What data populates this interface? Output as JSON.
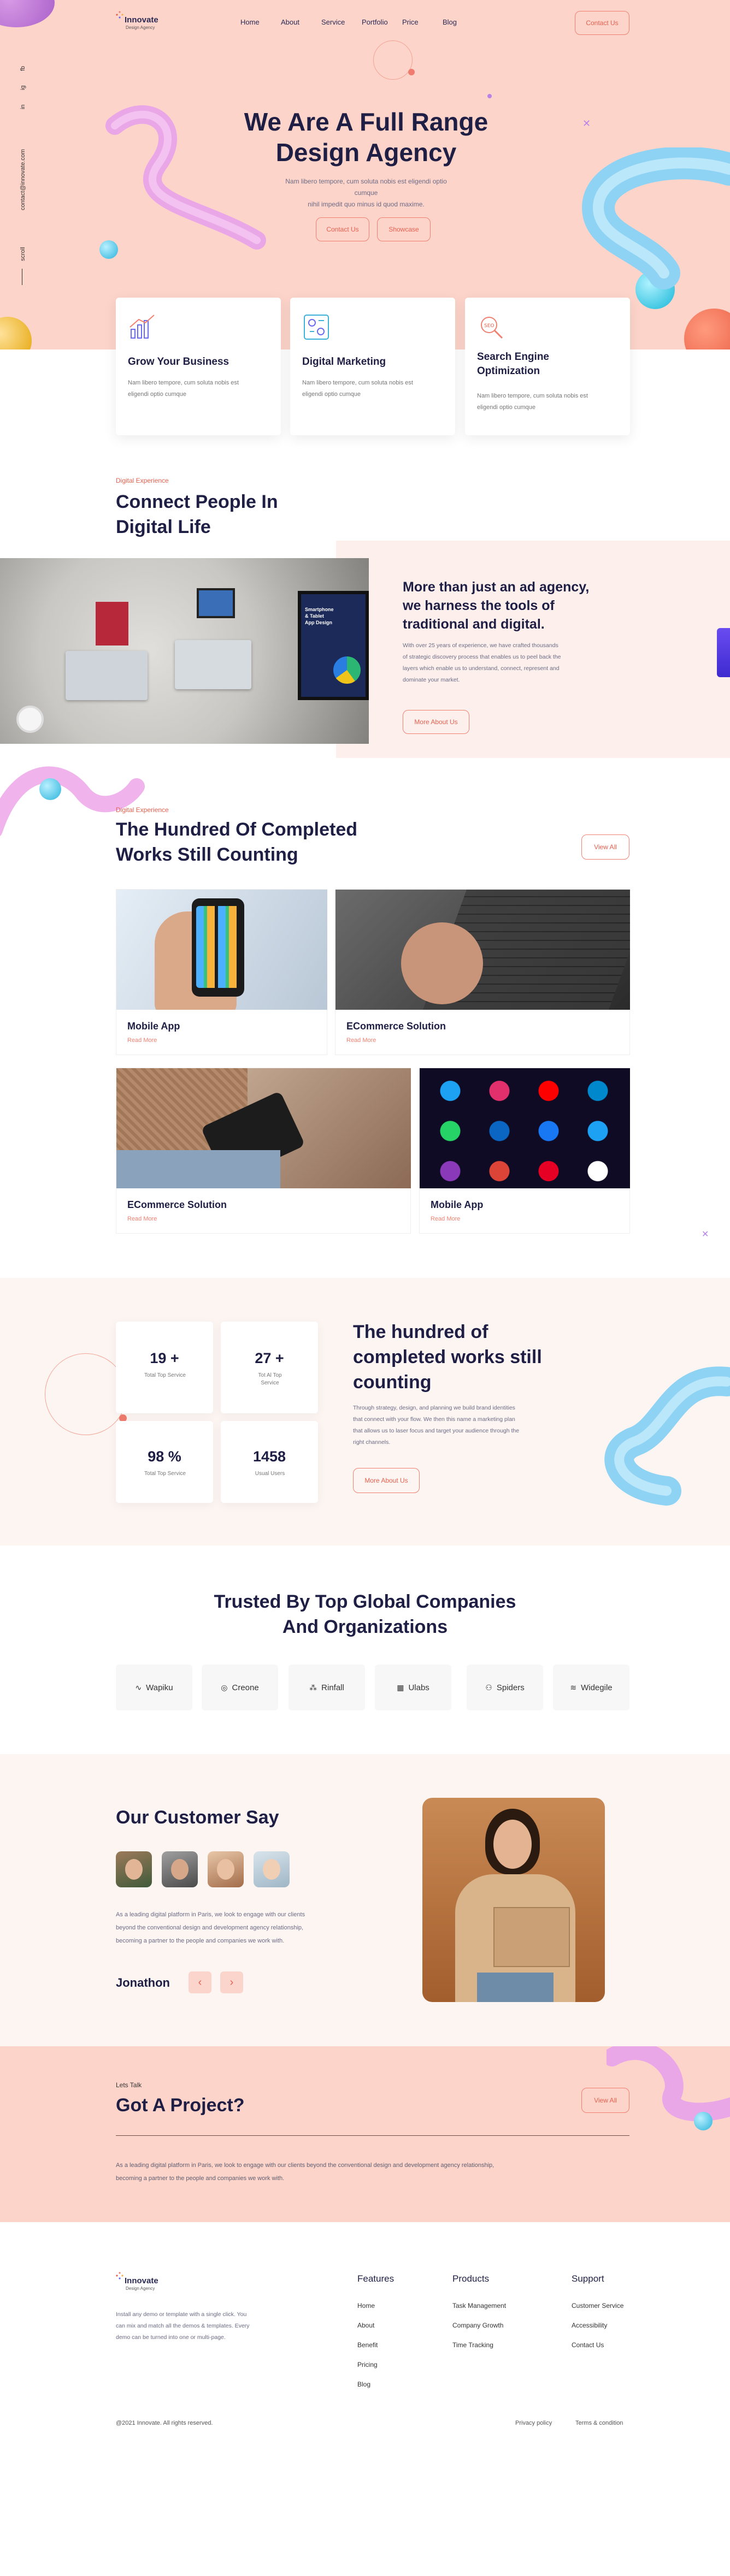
{
  "brand": {
    "name": "Innovate",
    "tagline": "Design Agency"
  },
  "nav": {
    "items": [
      "Home",
      "About",
      "Service",
      "Portfolio",
      "Price",
      "Blog"
    ],
    "contact_label": "Contact Us"
  },
  "sidebar": {
    "social": [
      "fb",
      "ig",
      "in"
    ],
    "email": "contact@innovate.com",
    "scroll_label": "scroll"
  },
  "hero": {
    "title_line1": "We Are A Full Range",
    "title_line2": "Design Agency",
    "subtitle_line1": "Nam libero tempore, cum soluta nobis est eligendi optio cumque",
    "subtitle_line2": "nihil impedit quo minus id quod maxime.",
    "btn_primary": "Contact Us",
    "btn_secondary": "Showcase"
  },
  "services": [
    {
      "title_line1": "Grow Your Business",
      "title_line2": "",
      "desc_line1": "Nam libero tempore, cum soluta nobis est",
      "desc_line2": "eligendi optio cumque",
      "icon": "chart-icon"
    },
    {
      "title_line1": "Digital Marketing",
      "title_line2": "",
      "desc_line1": "Nam libero tempore, cum soluta nobis est",
      "desc_line2": "eligendi optio cumque",
      "icon": "marketing-icon"
    },
    {
      "title_line1": "Search Engine",
      "title_line2": "Optimization",
      "desc_line1": "Nam libero tempore, cum soluta nobis est",
      "desc_line2": "eligendi optio cumque",
      "icon": "seo-icon"
    }
  ],
  "connect": {
    "eyebrow": "Digital Experience",
    "title_line1": "Connect People In",
    "title_line2": "Digital Life",
    "panel_title_line1": "More than just an ad agency,",
    "panel_title_line2": "we harness the tools of",
    "panel_title_line3": "traditional and digital.",
    "panel_text": [
      "With over 25 years of experience, we have crafted thousands",
      "of strategic discovery process that enables us to peel back the",
      "layers which enable us to understand, connect, represent and",
      "dominate your market."
    ],
    "btn": "More About Us",
    "screen_text_line1": "Smartphone",
    "screen_text_line2": "& Tablet",
    "screen_text_line3": "App Design"
  },
  "projects": {
    "eyebrow": "Digital Experience",
    "title_line1": "The Hundred Of Completed",
    "title_line2": "Works Still Counting",
    "view_all": "View All",
    "items": [
      {
        "title": "Mobile App",
        "link": "Read More"
      },
      {
        "title": "ECommerce Solution",
        "link": "Read More"
      },
      {
        "title": "ECommerce Solution",
        "link": "Read More"
      },
      {
        "title": "Mobile App",
        "link": "Read More"
      }
    ]
  },
  "stats": {
    "cards": [
      {
        "value": "19 +",
        "label_line1": "Total Top Service",
        "label_line2": ""
      },
      {
        "value": "27 +",
        "label_line1": "Tot Al Top",
        "label_line2": "Service"
      },
      {
        "value": "98 %",
        "label_line1": "Total Top Service",
        "label_line2": ""
      },
      {
        "value": "1458",
        "label_line1": "Usual Users",
        "label_line2": ""
      }
    ],
    "title_line1": "The hundred of",
    "title_line2": "completed works still",
    "title_line3": "counting",
    "text": [
      "Through strategy, design, and planning we build brand identities",
      "that connect with your flow. We then this name a marketing plan",
      "that allows us to laser focus and target your audience through the",
      "right channels."
    ],
    "btn": "More About Us"
  },
  "trusted": {
    "title_line1": "Trusted By Top Global Companies",
    "title_line2": "And Organizations",
    "logos": [
      "Wapiku",
      "Creone",
      "Rinfall",
      "Ulabs",
      "Spiders",
      "Widegile"
    ]
  },
  "testimonial": {
    "title": "Our Customer Say",
    "text": [
      "As a leading digital platform in Paris, we look to engage with our clients",
      "beyond the conventional design and development agency relationship,",
      "becoming a partner to the people and companies we work with."
    ],
    "name": "Jonathon",
    "prev": "‹",
    "next": "›"
  },
  "cta": {
    "eyebrow": "Lets Talk",
    "title": "Got A Project?",
    "btn": "View All",
    "text_line1": "As a leading digital platform in Paris, we look to engage with our clients beyond the conventional design and development agency relationship,",
    "text_line2": "becoming a partner to the people and companies we work with."
  },
  "footer": {
    "about_line1": "Install any demo or template with a single click. You",
    "about_line2": "can mix and match all the demos & templates. Every",
    "about_line3": "demo can be turned into one or multi-page.",
    "cols": [
      {
        "title": "Features",
        "links": [
          "Home",
          "About",
          "Benefit",
          "Pricing",
          "Blog"
        ]
      },
      {
        "title": "Products",
        "links": [
          "Task Management",
          "Company Growth",
          "Time Tracking"
        ]
      },
      {
        "title": "Support",
        "links": [
          "Customer Service",
          "Accessibility",
          "Contact Us"
        ]
      }
    ],
    "copyright": "@2021 Innovate. All rights reserved.",
    "privacy": "Privacy policy",
    "terms": "Terms & condition"
  },
  "colors": {
    "accent": "#f08172",
    "hero_bg": "#fdd4ca",
    "navy": "#1f1f45",
    "light_bg": "#fdf5f2"
  }
}
